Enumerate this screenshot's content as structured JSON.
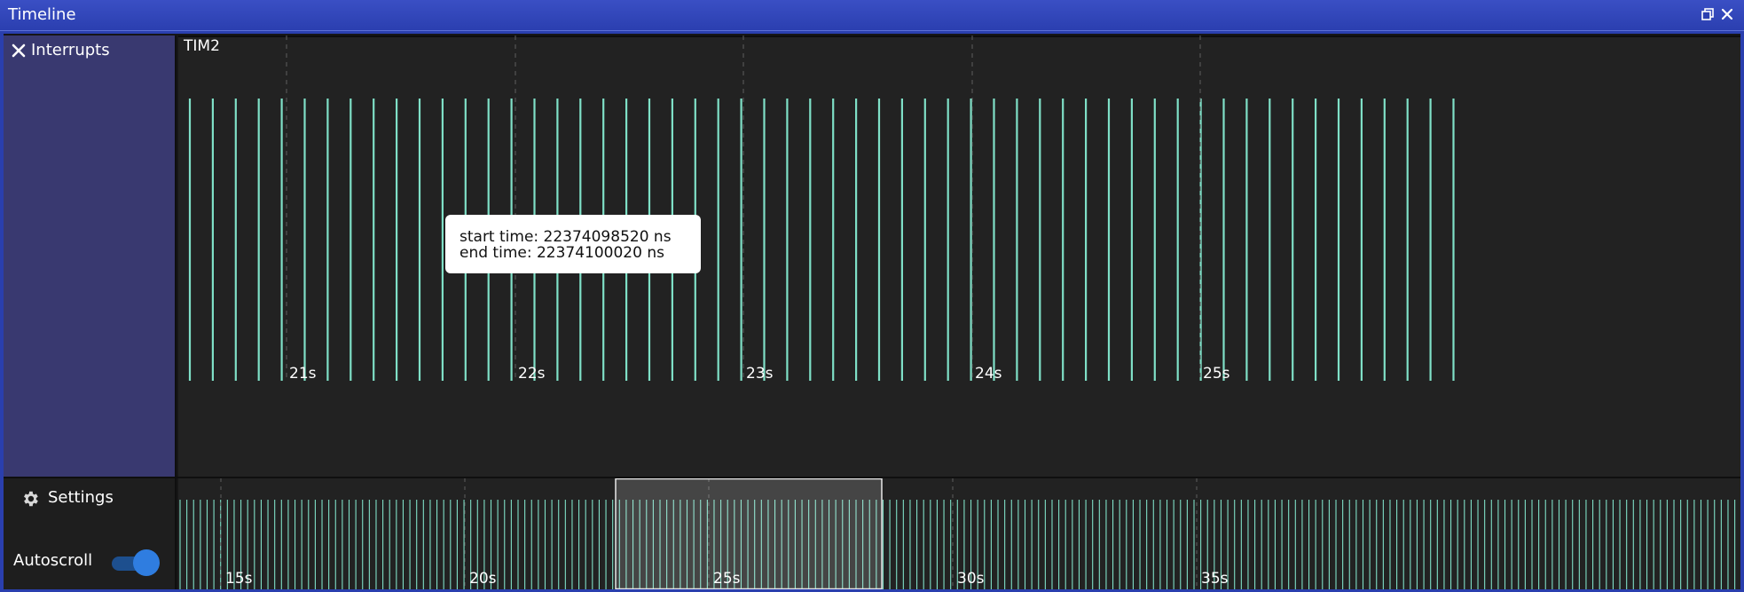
{
  "window": {
    "title": "Timeline"
  },
  "sidebar": {
    "group_label": "Interrupts"
  },
  "settings": {
    "label": "Settings",
    "autoscroll_label": "Autoscroll",
    "autoscroll_enabled": true
  },
  "tooltip": {
    "start": "start time: 22374098520 ns",
    "end": "end time: 22374100020 ns"
  },
  "main_timeline": {
    "track_label": "TIM2",
    "ticks": [
      "21s",
      "22s",
      "23s",
      "24s",
      "25s"
    ]
  },
  "overview_timeline": {
    "ticks": [
      "15s",
      "20s",
      "25s",
      "30s",
      "35s"
    ]
  },
  "colors": {
    "accent": "#2f7de0",
    "event": "#7fe0c7",
    "plot_bg": "#222222",
    "sidebar": "#393970",
    "titlebar": "#2b3fb0"
  }
}
